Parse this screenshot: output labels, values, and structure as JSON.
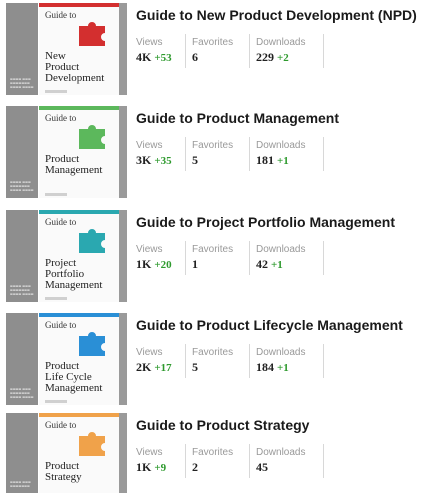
{
  "stat_labels": {
    "views": "Views",
    "favorites": "Favorites",
    "downloads": "Downloads"
  },
  "items": [
    {
      "title": "Guide to New Product Development (NPD)",
      "cover": {
        "guide": "Guide to",
        "lines": [
          "New",
          "Product",
          "Development"
        ],
        "accent": "#d32f2f",
        "icon": "puzzle-piece-icon"
      },
      "views": "4K",
      "views_delta": "+53",
      "favorites": "6",
      "downloads": "229",
      "downloads_delta": "+2"
    },
    {
      "title": "Guide to Product Management",
      "cover": {
        "guide": "Guide to",
        "lines": [
          "Product",
          "Management"
        ],
        "accent": "#5cb85c",
        "icon": "puzzle-piece-icon"
      },
      "views": "3K",
      "views_delta": "+35",
      "favorites": "5",
      "downloads": "181",
      "downloads_delta": "+1"
    },
    {
      "title": "Guide to Project Portfolio Management",
      "cover": {
        "guide": "Guide to",
        "lines": [
          "Project",
          "Portfolio",
          "Management"
        ],
        "accent": "#2aa8b0",
        "icon": "puzzle-piece-icon"
      },
      "views": "1K",
      "views_delta": "+20",
      "favorites": "1",
      "downloads": "42",
      "downloads_delta": "+1"
    },
    {
      "title": "Guide to Product Lifecycle Management",
      "cover": {
        "guide": "Guide to",
        "lines": [
          "Product",
          "Life Cycle",
          "Management"
        ],
        "accent": "#2a8fd6",
        "icon": "puzzle-piece-icon"
      },
      "views": "2K",
      "views_delta": "+17",
      "favorites": "5",
      "downloads": "184",
      "downloads_delta": "+1"
    },
    {
      "title": "Guide to Product Strategy",
      "cover": {
        "guide": "Guide to",
        "lines": [
          "Product",
          "Strategy"
        ],
        "accent": "#f0a24a",
        "icon": "puzzle-piece-icon"
      },
      "views": "1K",
      "views_delta": "+9",
      "favorites": "2",
      "downloads": "45",
      "downloads_delta": ""
    }
  ]
}
